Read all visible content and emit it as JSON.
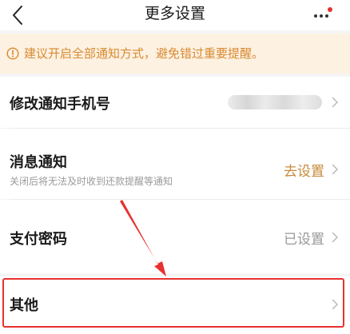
{
  "nav": {
    "back_icon": "chevron-left-icon",
    "title": "更多设置",
    "more_icon": "ellipsis-icon",
    "badge_color": "#e8312f"
  },
  "notice": {
    "icon": "info-circle-icon",
    "text": "建议开启全部通知方式，避免错过重要提醒。",
    "color": "#d88a32",
    "background": "#fdf1e1"
  },
  "rows": [
    {
      "title": "修改通知手机号",
      "value": "",
      "value_obscured": true
    },
    {
      "title": "消息通知",
      "subtitle": "关闭后将无法及时收到还款提醒等通知",
      "value": "去设置",
      "value_color": "#c8893a"
    },
    {
      "title": "支付密码",
      "value": "已设置",
      "value_color": "#999999"
    },
    {
      "title": "其他",
      "value": ""
    }
  ],
  "annotation": {
    "color": "#e8312f",
    "highlighted_row": "其他"
  }
}
